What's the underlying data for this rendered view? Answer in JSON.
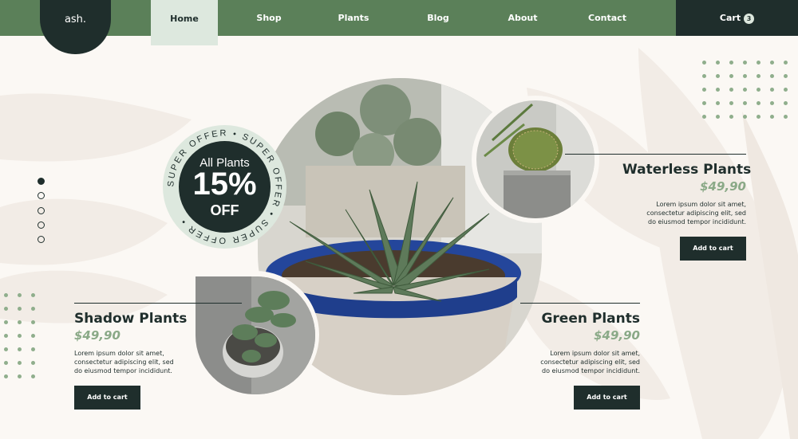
{
  "brand": {
    "logo": "ash."
  },
  "nav": {
    "items": [
      {
        "label": "Home",
        "active": true
      },
      {
        "label": "Shop",
        "active": false
      },
      {
        "label": "Plants",
        "active": false
      },
      {
        "label": "Blog",
        "active": false
      },
      {
        "label": "About",
        "active": false
      },
      {
        "label": "Contact",
        "active": false
      }
    ],
    "cart_label": "Cart",
    "cart_count": "3"
  },
  "offer": {
    "ring_text": "SUPER OFFER • SUPER OFFER • SUPER OFFER •",
    "line1": "All Plants",
    "line2": "15%",
    "line3": "OFF"
  },
  "slider": {
    "count": 5,
    "active_index": 0
  },
  "products": [
    {
      "title": "Waterless Plants",
      "price": "$49,90",
      "desc": [
        "Lorem ipsum dolor sit amet,",
        "consectetur adipiscing elit, sed",
        "do eiusmod tempor incididunt."
      ],
      "button": "Add to cart",
      "image_icon": "cactus-pot-icon"
    },
    {
      "title": "Shadow Plants",
      "price": "$49,90",
      "desc": [
        "Lorem ipsum dolor sit amet,",
        "consectetur adipiscing elit, sed",
        "do eiusmod tempor incididunt."
      ],
      "button": "Add to cart",
      "image_icon": "succulent-pot-icon"
    },
    {
      "title": "Green Plants",
      "price": "$49,90",
      "desc": [
        "Lorem ipsum dolor sit amet,",
        "consectetur adipiscing elit, sed",
        "do eiusmod tempor incididunt."
      ],
      "button": "Add to cart",
      "image_icon": "haworthia-pot-icon"
    }
  ],
  "colors": {
    "dark": "#1f2e2c",
    "green": "#5b8059",
    "mint": "#dde8de",
    "price": "#8aa987",
    "background": "#fbf8f4"
  }
}
